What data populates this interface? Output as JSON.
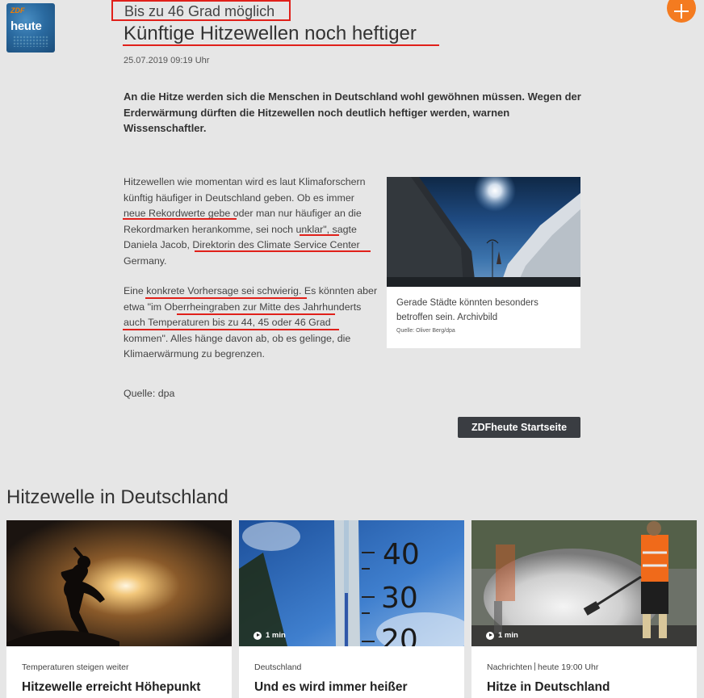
{
  "logo": {
    "brand": "ZDF",
    "name": "heute"
  },
  "colors": {
    "accent": "#f47b20",
    "annotation": "#e0201a",
    "button": "#3a3d42",
    "background": "#e6e6e6"
  },
  "article": {
    "kicker": "Bis zu 46 Grad möglich",
    "headline": "Künftige Hitzewellen noch heftiger",
    "date": "25.07.2019 09:19 Uhr",
    "lead": "An die Hitze werden sich die Menschen in Deutschland wohl gewöhnen müssen. Wegen der Erderwärmung dürften die Hitzewellen noch deutlich heftiger werden, warnen Wissenschaftler.",
    "paragraph1": "Hitzewellen wie momentan wird es laut Klimaforschern künftig häufiger in Deutschland geben. Ob es immer neue Rekordwerte gebe oder man nur häufiger an die Rekordmarken herankomme, sei noch unklar\", sagte Daniela Jacob, Direktorin des Climate Service Center Germany.",
    "paragraph2": "Eine konkrete Vorhersage sei schwierig. Es könnten aber etwa \"im Oberrheingraben zur Mitte des Jahrhunderts auch Temperaturen bis zu 44, 45 oder 46 Grad kommen\". Alles hänge davon ab, ob es gelinge, die Klimaerwärmung zu begrenzen.",
    "source": "Quelle: dpa",
    "figure": {
      "caption": "Gerade Städte könnten besonders betroffen sein. Archivbild",
      "credit": "Quelle: Oliver Berg/dpa"
    },
    "start_button": "ZDFheute Startseite"
  },
  "related": {
    "section_title": "Hitzewelle in Deutschland",
    "cards": [
      {
        "meta": "Temperaturen steigen weiter",
        "meta_extra": "",
        "title": "Hitzewelle erreicht Höhepunkt",
        "duration": ""
      },
      {
        "meta": "Deutschland",
        "meta_extra": "",
        "title": "Und es wird immer heißer",
        "duration": "1 min"
      },
      {
        "meta": "Nachrichten",
        "meta_extra": "heute 19:00 Uhr",
        "title": "Hitze in Deutschland",
        "duration": "1 min"
      }
    ]
  }
}
